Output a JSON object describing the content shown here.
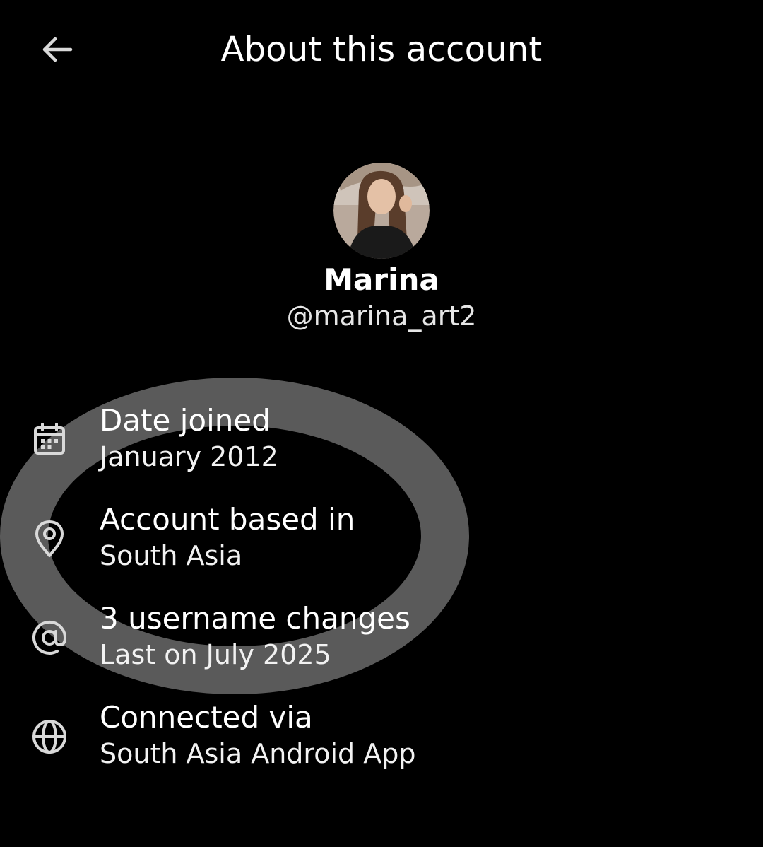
{
  "header": {
    "back_icon": "arrow-left-icon",
    "title": "About this account"
  },
  "profile": {
    "avatar_icon": "avatar-photo",
    "display_name": "Marina",
    "handle": "@marina_art2"
  },
  "details": [
    {
      "icon": "calendar-icon",
      "label": "Date joined",
      "value": "January 2012"
    },
    {
      "icon": "location-pin-icon",
      "label": "Account based in",
      "value": "South Asia"
    },
    {
      "icon": "at-sign-icon",
      "label": "3 username changes",
      "value": "Last on July 2025"
    },
    {
      "icon": "globe-icon",
      "label": "Connected via",
      "value": "South Asia Android App"
    }
  ],
  "colors": {
    "background": "#000000",
    "text": "#ffffff",
    "icon": "#d9d9d9",
    "highlight_ring": "#5a5a5a"
  }
}
